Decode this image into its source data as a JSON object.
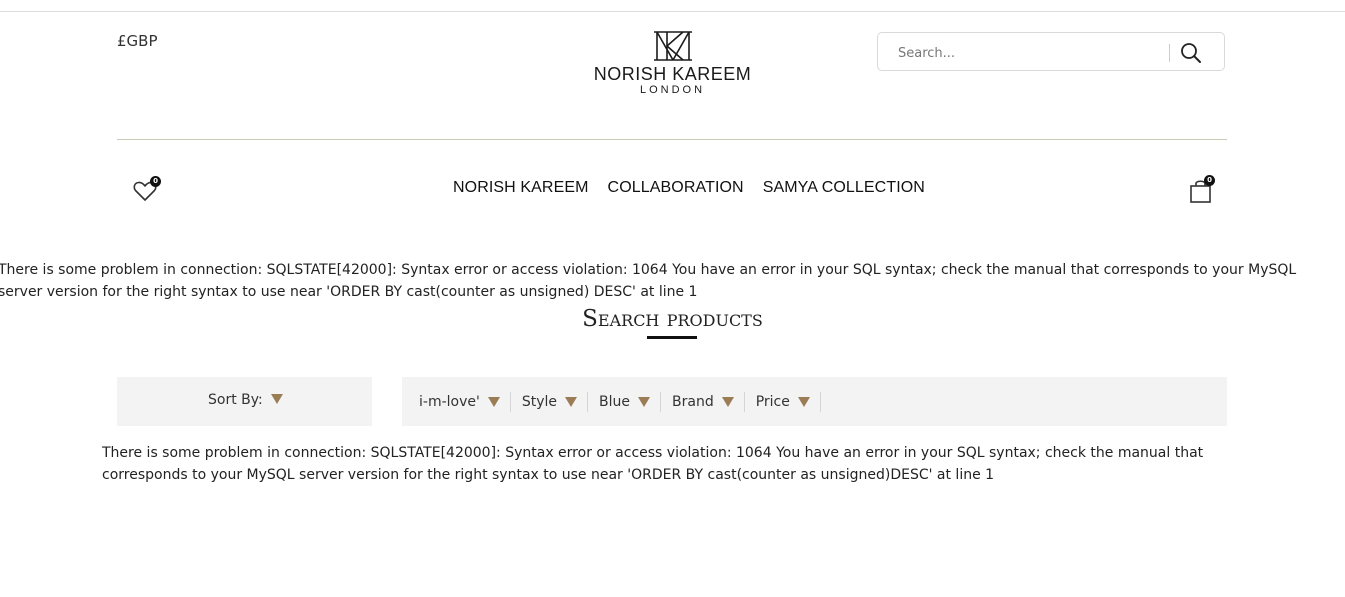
{
  "header": {
    "currency": "£GBP",
    "logo": {
      "name": "NORISH KAREEM",
      "sub": "LONDON"
    },
    "search": {
      "placeholder": "Search..."
    }
  },
  "nav": {
    "items": [
      {
        "label": "NORISH KAREEM"
      },
      {
        "label": "COLLABORATION"
      },
      {
        "label": "SAMYA COLLECTION"
      }
    ],
    "wishlist_count": "0",
    "cart_count": "0"
  },
  "errors": {
    "top": "There is some problem in connection: SQLSTATE[42000]: Syntax error or access violation: 1064 You have an error in your SQL syntax; check the manual that corresponds to your MySQL server version for the right syntax to use near 'ORDER BY cast(counter as unsigned) DESC' at line 1",
    "bottom": "There is some problem in connection: SQLSTATE[42000]: Syntax error or access violation: 1064 You have an error in your SQL syntax; check the manual that corresponds to your MySQL server version for the right syntax to use near 'ORDER BY cast(counter as unsigned)DESC' at line 1"
  },
  "page": {
    "title": "Search products"
  },
  "sort": {
    "label": "Sort By:"
  },
  "filters": [
    {
      "label": "i-m-love'"
    },
    {
      "label": "Style"
    },
    {
      "label": "Blue"
    },
    {
      "label": "Brand"
    },
    {
      "label": "Price"
    }
  ],
  "colors": {
    "accent": "#9a7d55",
    "rule": "#c9cbb6",
    "panel": "#f3f3f3"
  }
}
